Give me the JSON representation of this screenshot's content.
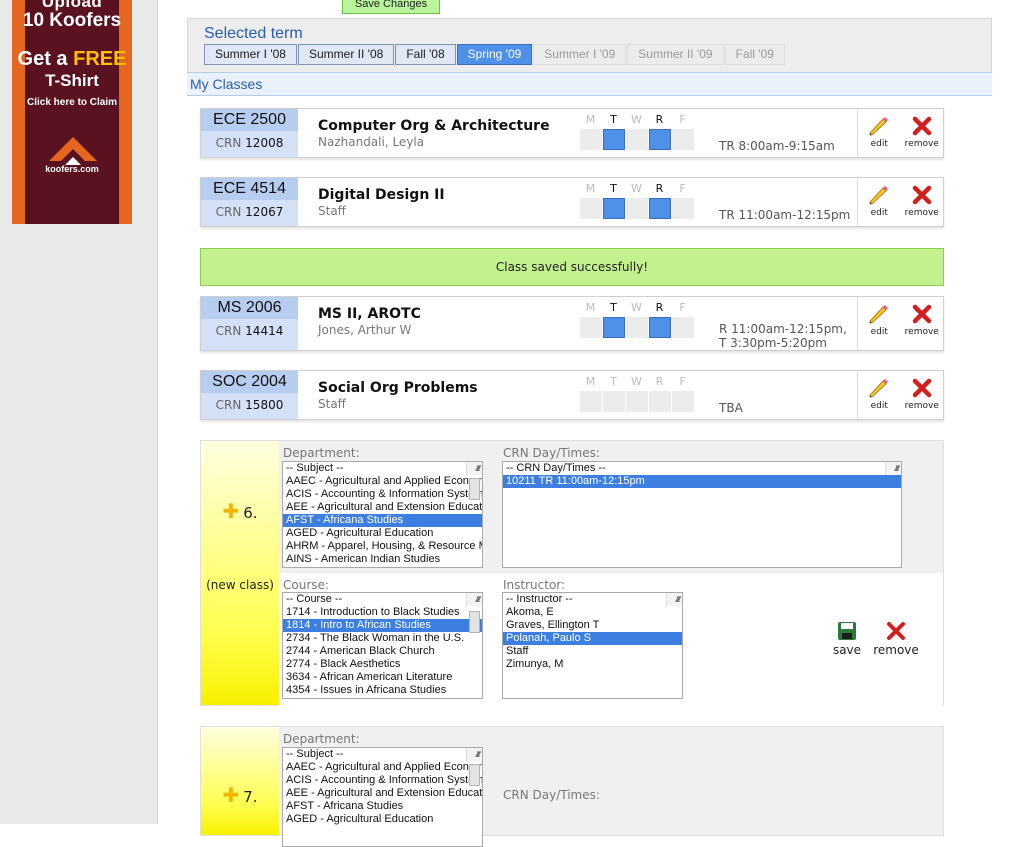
{
  "ad": {
    "line1": "Upload",
    "line2": "10 Koofers",
    "line3a": "Get a ",
    "line3b": "FREE",
    "line4": "T-Shirt",
    "line5": "Click here to Claim",
    "logo_text": "koofers.com"
  },
  "save_changes": "Save Changes",
  "term": {
    "title": "Selected term",
    "tabs": [
      {
        "label": "Summer I '08",
        "state": "normal"
      },
      {
        "label": "Summer II '08",
        "state": "normal"
      },
      {
        "label": "Fall '08",
        "state": "normal"
      },
      {
        "label": "Spring '09",
        "state": "selected"
      },
      {
        "label": "Summer I '09",
        "state": "disabled"
      },
      {
        "label": "Summer II '09",
        "state": "disabled"
      },
      {
        "label": "Fall '09",
        "state": "disabled"
      }
    ]
  },
  "my_classes": "My Classes",
  "day_letters": [
    "M",
    "T",
    "W",
    "R",
    "F"
  ],
  "crn_label": "CRN",
  "edit": "edit",
  "remove": "remove",
  "save": "save",
  "classes": [
    {
      "code": "ECE 2500",
      "crn": "12008",
      "title": "Computer Org & Architecture",
      "prof": "Nazhandali, Leyla",
      "days": [
        false,
        true,
        false,
        true,
        false
      ],
      "time1": "TR 8:00am-9:15am",
      "time2": ""
    },
    {
      "code": "ECE 4514",
      "crn": "12067",
      "title": "Digital Design II",
      "prof": "Staff",
      "days": [
        false,
        true,
        false,
        true,
        false
      ],
      "time1": "TR 11:00am-12:15pm",
      "time2": ""
    },
    {
      "code": "MS 2006",
      "crn": "14414",
      "title": "MS II, AROTC",
      "prof": "Jones, Arthur W",
      "days": [
        false,
        true,
        false,
        true,
        false
      ],
      "time1": "R 11:00am-12:15pm,",
      "time2": "T 3:30pm-5:20pm"
    },
    {
      "code": "SOC 2004",
      "crn": "15800",
      "title": "Social Org Problems",
      "prof": "Staff",
      "days": [
        false,
        false,
        false,
        false,
        false
      ],
      "time1": "TBA",
      "time2": ""
    }
  ],
  "success": "Class saved successfully!",
  "new6": {
    "num": "6.",
    "new_label": "(new class)",
    "dept_label": "Department:",
    "crn_label": "CRN Day/Times:",
    "course_label": "Course:",
    "instr_label": "Instructor:",
    "dept": [
      "-- Subject --",
      "AAEC - Agricultural and Applied Economics",
      "ACIS - Accounting & Information Systems",
      "AEE - Agricultural and Extension Education",
      "AFST - Africana Studies",
      "AGED - Agricultural Education",
      "AHRM - Apparel, Housing, & Resource Management",
      "AINS - American Indian Studies"
    ],
    "dept_sel": 4,
    "crn": [
      "-- CRN Day/Times --",
      "10211 TR 11:00am-12:15pm"
    ],
    "crn_sel": 1,
    "course": [
      "-- Course --",
      "1714 - Introduction to Black Studies",
      "1814 - Intro to African Studies",
      "2734 - The Black Woman in the U.S.",
      "2744 - American Black Church",
      "2774 - Black Aesthetics",
      "3634 - African American Literature",
      "4354 - Issues in Africana Studies"
    ],
    "course_sel": 2,
    "instr": [
      "-- Instructor --",
      "Akoma, E",
      "Graves, Ellington T",
      "Polanah, Paulo S",
      "Staff",
      "Zimunya, M"
    ],
    "instr_sel": 3
  },
  "new7": {
    "num": "7.",
    "dept_label": "Department:",
    "crn_label": "CRN Day/Times:",
    "dept": [
      "-- Subject --",
      "AAEC - Agricultural and Applied Economics",
      "ACIS - Accounting & Information Systems",
      "AEE - Agricultural and Extension Education",
      "AFST - Africana Studies",
      "AGED - Agricultural Education"
    ]
  },
  "colors": {
    "accent": "#4f90e8",
    "success": "#c2f18e",
    "link": "#2a5db0"
  }
}
